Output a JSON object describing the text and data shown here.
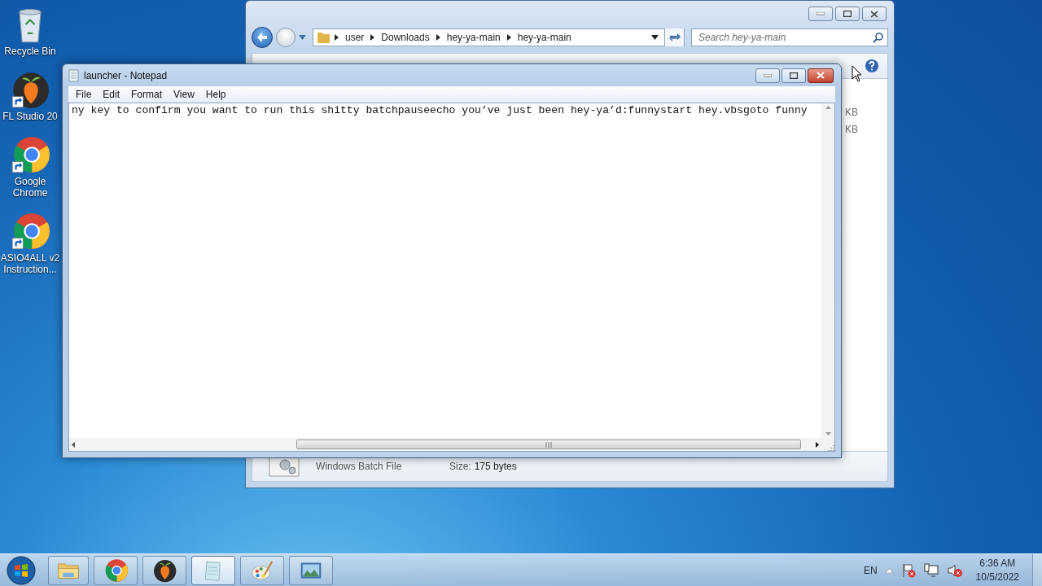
{
  "desktop_icons": [
    {
      "kind": "recycle",
      "label": "Recycle Bin"
    },
    {
      "kind": "fruit",
      "label": "FL Studio 20"
    },
    {
      "kind": "browser",
      "label": "Google Chrome"
    },
    {
      "kind": "browser",
      "label": "ASIO4ALL v2 Instruction..."
    }
  ],
  "explorer": {
    "breadcrumb": [
      "user",
      "Downloads",
      "hey-ya-main",
      "hey-ya-main"
    ],
    "search": {
      "placeholder": "Search hey-ya-main"
    },
    "file_sizes": [
      "KB",
      "KB"
    ],
    "details": {
      "type": "Windows Batch File",
      "size_label": "Size:",
      "size_value": "175 bytes"
    }
  },
  "notepad": {
    "title": "launcher - Notepad",
    "menu": [
      "File",
      "Edit",
      "Format",
      "View",
      "Help"
    ],
    "content": "ny key to confirm you want to run this shitty batchpauseecho you’ve just been hey-ya’d:funnystart hey.vbsgoto funny"
  },
  "taskbar": {
    "apps": [
      {
        "kind": "folder",
        "selected": false
      },
      {
        "kind": "browser",
        "selected": false
      },
      {
        "kind": "fruit",
        "selected": false
      },
      {
        "kind": "notepad",
        "selected": true
      },
      {
        "kind": "palette",
        "selected": false
      },
      {
        "kind": "picture",
        "selected": false
      }
    ],
    "language": "EN",
    "time": "6:36 AM",
    "date": "10/5/2022"
  }
}
